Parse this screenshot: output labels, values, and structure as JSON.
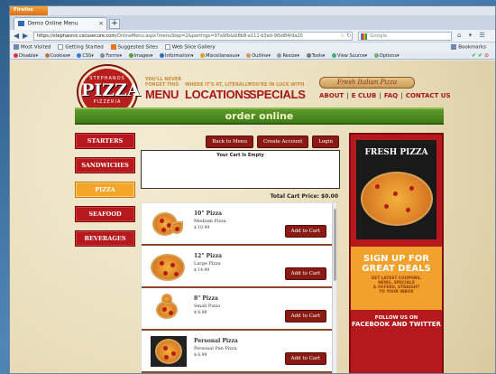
{
  "browser": {
    "app_button": "Firefox",
    "tab_title": "Demo Online Menu",
    "new_tab": "+",
    "url_host": "https://stephannic.cscusecure.com",
    "url_path": "/OnlineMenu.aspx?menuStep=2&partIngs=97a9fb&ib8b8-a111-b3ed-9fbd84/da20",
    "search_placeholder": "Google",
    "bookmarks": [
      "Most Visited",
      "Getting Started",
      "Suggested Sites",
      "Web Slice Gallery"
    ],
    "bookmarks_right": "Bookmarks",
    "dev_toolbar": [
      "Disable",
      "Cookies",
      "CSS",
      "Forms",
      "Images",
      "Information",
      "Miscellaneous",
      "Outline",
      "Resize",
      "Tools",
      "View Source",
      "Options"
    ]
  },
  "site": {
    "logo_top": "STEPHANOS",
    "logo_main": "PIZZA",
    "logo_bottom": "PIZZERIA",
    "nav": [
      {
        "small": "YOU'LL NEVER\nFORGET THIS",
        "big": "MENU"
      },
      {
        "small": "WHERE IT'S AT, LITERALLY",
        "big": "LOCATIONS"
      },
      {
        "small": "YOU'RE IN LUCK WITH",
        "big": "SPECIALS"
      }
    ],
    "sign": "Fresh Italian Pizza",
    "toplinks": [
      "ABOUT",
      "E CLUB",
      "FAQ",
      "CONTACT US"
    ],
    "banner": "order online"
  },
  "sidenav": [
    "STARTERS",
    "SANDWICHES",
    "PIZZA",
    "SEAFOOD",
    "BEVERAGES"
  ],
  "sidenav_active_index": 2,
  "cart": {
    "buttons": [
      "Back to Menu",
      "Create Account",
      "Login"
    ],
    "empty_text": "Your Cart Is Empty",
    "total_label": "Total Cart Price: $0.00"
  },
  "menu_items": [
    {
      "title": "10\" Pizza",
      "desc": "Medium Pizza",
      "price": "$ 10.99",
      "button": "Add to Cart",
      "icon": "sliced-pizza"
    },
    {
      "title": "12\" Pizza",
      "desc": "Large Pizza",
      "price": "$ 14.99",
      "button": "Add to Cart",
      "icon": "whole-pizza"
    },
    {
      "title": "8\" Pizza",
      "desc": "Small Pizza",
      "price": "$ 8.99",
      "button": "Add to Cart",
      "icon": "small-pizza"
    },
    {
      "title": "Personal Pizza",
      "desc": "Personal Pan Pizza",
      "price": "$ 6.99",
      "button": "Add to Cart",
      "icon": "pan-pizza"
    }
  ],
  "ad": {
    "heading": "FRESH PIZZA",
    "signup": "SIGN UP FOR\nGREAT DEALS",
    "signup_sub": "GET LATEST COUPONS,\nNEWS, SPECIALS\n& OFFERS, STRAIGHT\nTO YOUR INBOX",
    "follow": "FOLLOW US ON",
    "social": "FACEBOOK AND TWITTER"
  },
  "colors": {
    "brand_red": "#b5181d",
    "banner_green": "#4f8a22",
    "active_orange": "#f4a52a",
    "button_brown": "#8a1a14"
  }
}
